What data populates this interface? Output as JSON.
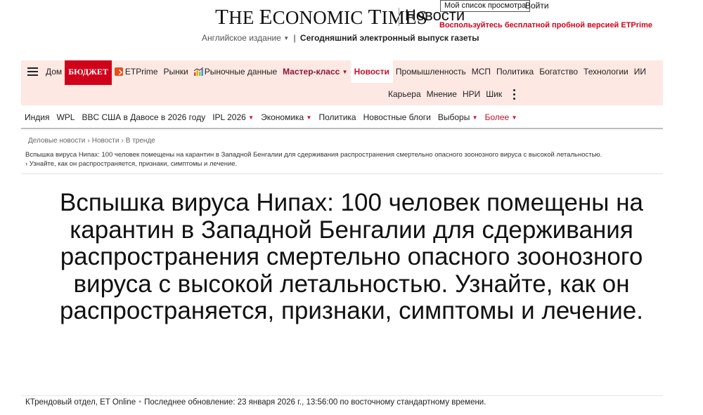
{
  "masthead": {
    "logo_text": "The Economic Times",
    "section_name": "Новости",
    "watchlist_label": "Мой список просмотра",
    "login_label": "Войти",
    "promo_label": "Воспользуйтесь бесплатной пробной версией ETPrime",
    "edition_label": "Английское издание",
    "epaper_label": "Сегодняшний электронный выпуск газеты"
  },
  "main_nav": {
    "row1": [
      {
        "label": "Дом"
      },
      {
        "label": "БЮДЖЕТ"
      },
      {
        "label": "ETPrime"
      },
      {
        "label": "Рынки"
      },
      {
        "label": "Рыночные данные"
      },
      {
        "label": "Мастер-класс"
      },
      {
        "label": "Новости"
      },
      {
        "label": "Промышленность"
      },
      {
        "label": "МСП"
      },
      {
        "label": "Политика"
      },
      {
        "label": "Богатство"
      },
      {
        "label": "Технологии"
      },
      {
        "label": "ИИ"
      }
    ],
    "row2": [
      {
        "label": "Карьера"
      },
      {
        "label": "Мнение"
      },
      {
        "label": "НРИ"
      },
      {
        "label": "Шик"
      }
    ]
  },
  "sub_nav": [
    {
      "label": "Индия"
    },
    {
      "label": "WPL"
    },
    {
      "label": "BBC США в Давосе в 2026 году"
    },
    {
      "label": "IPL 2026"
    },
    {
      "label": "Экономика"
    },
    {
      "label": "Политика"
    },
    {
      "label": "Новостные блоги"
    },
    {
      "label": "Выборы"
    },
    {
      "label": "Более"
    }
  ],
  "breadcrumb": [
    "Деловые новости",
    "Новости",
    "В тренде"
  ],
  "story_tags": {
    "line1": "Вспышка вируса Нипах: 100 человек помещены на карантин в Западной Бенгалии для сдерживания распространения смертельно опасного зоонозного вируса с высокой летальностью.",
    "line2": "› Узнайте, как он распространяется, признаки, симптомы и лечение."
  },
  "article": {
    "headline": "Вспышка вируса Нипах: 100 человек помещены на карантин в Западной Бенгалии для сдерживания распространения смертельно опасного зоонозного вируса с высокой летальностью. Узнайте, как он распространяется, признаки, симптомы и лечение.",
    "author": "КТрендовый отдел, ET Online",
    "updated": "Последнее обновление: 23 января 2026 г., 13:56:00 по восточному стандартному времени."
  },
  "colors": {
    "brand_red": "#d0021b",
    "nav_background": "#fde8e3",
    "masterclass": "#8b1538"
  },
  "icons": [
    "hamburger-menu-icon",
    "etprime-icon",
    "market-chart-icon",
    "more-dots-icon",
    "chevron-down-icon"
  ]
}
